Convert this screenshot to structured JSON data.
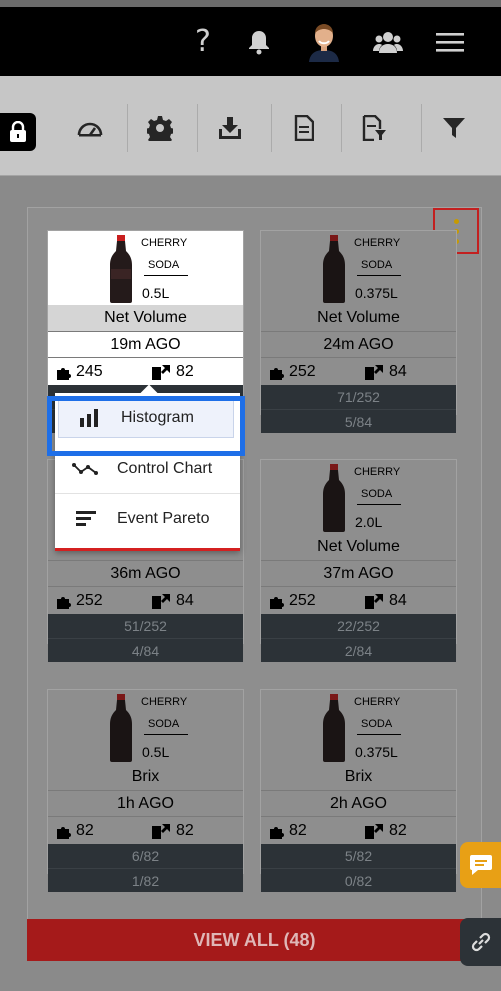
{
  "header": {
    "help_label": "?",
    "icons": [
      "help-icon",
      "bell-icon",
      "avatar",
      "users-icon",
      "menu-icon"
    ]
  },
  "toolbar": {
    "icons": [
      "lock-icon",
      "speedometer-icon",
      "gear-icon",
      "download-icon",
      "document-icon",
      "export-icon",
      "filter-icon"
    ]
  },
  "cards": [
    {
      "brand1": "CHERRY",
      "brand2": "SODA",
      "size": "0.5L",
      "metric": "Net Volume",
      "time": "19m AGO",
      "count_a": "245",
      "count_b": "82",
      "ratio1": "",
      "ratio2": ""
    },
    {
      "brand1": "CHERRY",
      "brand2": "SODA",
      "size": "0.375L",
      "metric": "Net Volume",
      "time": "24m AGO",
      "count_a": "252",
      "count_b": "84",
      "ratio1": "71/252",
      "ratio2": "5/84"
    },
    {
      "brand1": "",
      "brand2": "",
      "size": "",
      "metric": "",
      "time": "36m AGO",
      "count_a": "252",
      "count_b": "84",
      "ratio1": "51/252",
      "ratio2": "4/84"
    },
    {
      "brand1": "CHERRY",
      "brand2": "SODA",
      "size": "2.0L",
      "metric": "Net Volume",
      "time": "37m AGO",
      "count_a": "252",
      "count_b": "84",
      "ratio1": "22/252",
      "ratio2": "2/84"
    },
    {
      "brand1": "CHERRY",
      "brand2": "SODA",
      "size": "0.5L",
      "metric": "Brix",
      "time": "1h AGO",
      "count_a": "82",
      "count_b": "82",
      "ratio1": "6/82",
      "ratio2": "1/82"
    },
    {
      "brand1": "CHERRY",
      "brand2": "SODA",
      "size": "0.375L",
      "metric": "Brix",
      "time": "2h AGO",
      "count_a": "82",
      "count_b": "82",
      "ratio1": "5/82",
      "ratio2": "0/82"
    }
  ],
  "popup": {
    "items": [
      {
        "label": "Histogram",
        "icon": "bar-chart-icon"
      },
      {
        "label": "Control Chart",
        "icon": "line-chart-icon"
      },
      {
        "label": "Event Pareto",
        "icon": "list-lines-icon"
      }
    ]
  },
  "view_all": "VIEW ALL (48)",
  "colors": {
    "header_bg": "#000000",
    "accent_red": "#a51a1a",
    "highlight_blue": "#1e6fe8",
    "chat_orange": "#e8a015",
    "ratio_bg": "#2c3237"
  }
}
